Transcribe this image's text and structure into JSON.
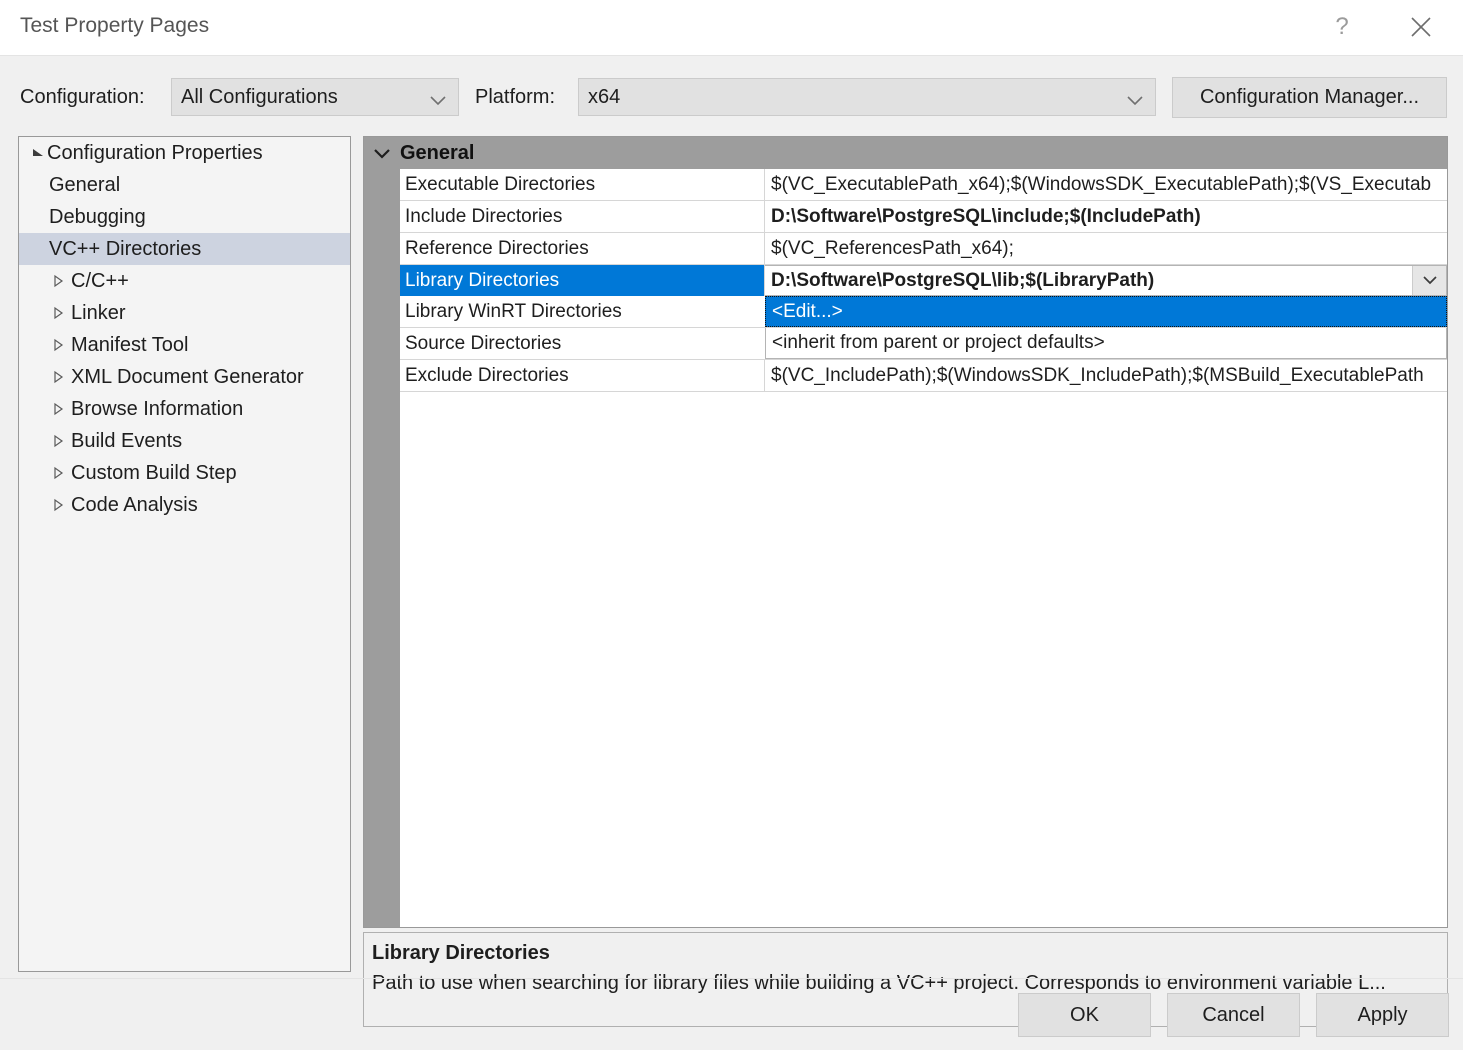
{
  "window": {
    "title": "Test Property Pages",
    "help_icon": "question-mark-icon",
    "close_icon": "close-x-icon"
  },
  "toolbar": {
    "configuration_label": "Configuration:",
    "configuration_value": "All Configurations",
    "platform_label": "Platform:",
    "platform_value": "x64",
    "configuration_manager_label": "Configuration Manager..."
  },
  "sidebar": {
    "items": [
      {
        "label": "Configuration Properties",
        "level": 0,
        "expander": "expanded-triangle-icon",
        "selected": false
      },
      {
        "label": "General",
        "level": 1,
        "expander": "none",
        "selected": false
      },
      {
        "label": "Debugging",
        "level": 1,
        "expander": "none",
        "selected": false
      },
      {
        "label": "VC++ Directories",
        "level": 1,
        "expander": "none",
        "selected": true
      },
      {
        "label": "C/C++",
        "level": 1,
        "expander": "collapsed-triangle-icon",
        "selected": false
      },
      {
        "label": "Linker",
        "level": 1,
        "expander": "collapsed-triangle-icon",
        "selected": false
      },
      {
        "label": "Manifest Tool",
        "level": 1,
        "expander": "collapsed-triangle-icon",
        "selected": false
      },
      {
        "label": "XML Document Generator",
        "level": 1,
        "expander": "collapsed-triangle-icon",
        "selected": false
      },
      {
        "label": "Browse Information",
        "level": 1,
        "expander": "collapsed-triangle-icon",
        "selected": false
      },
      {
        "label": "Build Events",
        "level": 1,
        "expander": "collapsed-triangle-icon",
        "selected": false
      },
      {
        "label": "Custom Build Step",
        "level": 1,
        "expander": "collapsed-triangle-icon",
        "selected": false
      },
      {
        "label": "Code Analysis",
        "level": 1,
        "expander": "collapsed-triangle-icon",
        "selected": false
      }
    ]
  },
  "grid": {
    "section_header": "General",
    "section_chevron": "chevron-down-icon",
    "rows": [
      {
        "name": "Executable Directories",
        "value": "$(VC_ExecutablePath_x64);$(WindowsSDK_ExecutablePath);$(VS_Executab",
        "bold": false,
        "state": "normal"
      },
      {
        "name": "Include Directories",
        "value": "D:\\Software\\PostgreSQL\\include;$(IncludePath)",
        "bold": true,
        "state": "normal"
      },
      {
        "name": "Reference Directories",
        "value": "$(VC_ReferencesPath_x64);",
        "bold": false,
        "state": "normal"
      },
      {
        "name": "Library Directories",
        "value": "D:\\Software\\PostgreSQL\\lib;$(LibraryPath)",
        "bold": true,
        "state": "editing",
        "dropdown_icon": "chevron-down-icon"
      },
      {
        "name": "Library WinRT Directories",
        "value": "<Edit...>",
        "bold": false,
        "state": "dropdown-item"
      },
      {
        "name": "Source Directories",
        "value": "<inherit from parent or project defaults>",
        "bold": false,
        "state": "dropdown-plain"
      },
      {
        "name": "Exclude Directories",
        "value": "$(VC_IncludePath);$(WindowsSDK_IncludePath);$(MSBuild_ExecutablePath",
        "bold": false,
        "state": "normal"
      }
    ]
  },
  "description": {
    "title": "Library Directories",
    "text": "Path to use when searching for library files while building a VC++ project.  Corresponds to environment variable L..."
  },
  "footer": {
    "ok_label": "OK",
    "cancel_label": "Cancel",
    "apply_label": "Apply"
  },
  "colors": {
    "selection_blue": "#0078d7",
    "tree_selection": "#cdd3e0",
    "header_gray": "#9d9d9d",
    "dialog_bg": "#f0f0f0"
  }
}
